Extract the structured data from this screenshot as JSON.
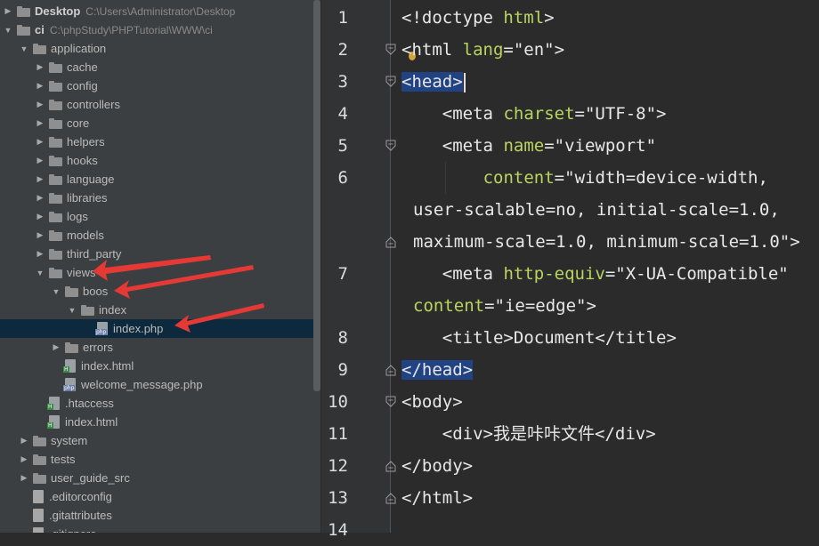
{
  "tree": [
    {
      "label": "Desktop",
      "path": "C:\\Users\\Administrator\\Desktop",
      "depth": 0,
      "kind": "folder",
      "state": "collapsed",
      "bold": true
    },
    {
      "label": "ci",
      "path": "C:\\phpStudy\\PHPTutorial\\WWW\\ci",
      "depth": 0,
      "kind": "folder",
      "state": "expanded",
      "bold": true
    },
    {
      "label": "application",
      "depth": 1,
      "kind": "folder",
      "state": "expanded"
    },
    {
      "label": "cache",
      "depth": 2,
      "kind": "folder",
      "state": "collapsed"
    },
    {
      "label": "config",
      "depth": 2,
      "kind": "folder",
      "state": "collapsed"
    },
    {
      "label": "controllers",
      "depth": 2,
      "kind": "folder",
      "state": "collapsed"
    },
    {
      "label": "core",
      "depth": 2,
      "kind": "folder",
      "state": "collapsed"
    },
    {
      "label": "helpers",
      "depth": 2,
      "kind": "folder",
      "state": "collapsed"
    },
    {
      "label": "hooks",
      "depth": 2,
      "kind": "folder",
      "state": "collapsed"
    },
    {
      "label": "language",
      "depth": 2,
      "kind": "folder",
      "state": "collapsed"
    },
    {
      "label": "libraries",
      "depth": 2,
      "kind": "folder",
      "state": "collapsed"
    },
    {
      "label": "logs",
      "depth": 2,
      "kind": "folder",
      "state": "collapsed"
    },
    {
      "label": "models",
      "depth": 2,
      "kind": "folder",
      "state": "collapsed"
    },
    {
      "label": "third_party",
      "depth": 2,
      "kind": "folder",
      "state": "collapsed"
    },
    {
      "label": "views",
      "depth": 2,
      "kind": "folder",
      "state": "expanded"
    },
    {
      "label": "boos",
      "depth": 3,
      "kind": "folder",
      "state": "expanded"
    },
    {
      "label": "index",
      "depth": 4,
      "kind": "folder",
      "state": "expanded"
    },
    {
      "label": "index.php",
      "depth": 5,
      "kind": "php",
      "selected": true
    },
    {
      "label": "errors",
      "depth": 3,
      "kind": "folder",
      "state": "collapsed"
    },
    {
      "label": "index.html",
      "depth": 3,
      "kind": "html"
    },
    {
      "label": "welcome_message.php",
      "depth": 3,
      "kind": "php"
    },
    {
      "label": ".htaccess",
      "depth": 2,
      "kind": "htaccess"
    },
    {
      "label": "index.html",
      "depth": 2,
      "kind": "html"
    },
    {
      "label": "system",
      "depth": 1,
      "kind": "folder",
      "state": "collapsed"
    },
    {
      "label": "tests",
      "depth": 1,
      "kind": "folder",
      "state": "collapsed"
    },
    {
      "label": "user_guide_src",
      "depth": 1,
      "kind": "folder",
      "state": "collapsed"
    },
    {
      "label": ".editorconfig",
      "depth": 1,
      "kind": "plain"
    },
    {
      "label": ".gitattributes",
      "depth": 1,
      "kind": "plain"
    },
    {
      "label": ".gitignore",
      "depth": 1,
      "kind": "plain"
    }
  ],
  "editor": {
    "line_numbers": [
      "1",
      "2",
      "3",
      "4",
      "5",
      "6",
      "",
      "",
      "7",
      "",
      "8",
      "9",
      "10",
      "11",
      "12",
      "13",
      "14"
    ],
    "lines": [
      {
        "indent": 0,
        "segs": [
          [
            "t",
            "<!doctype "
          ],
          [
            "an",
            "html"
          ],
          [
            "t",
            ">"
          ]
        ]
      },
      {
        "indent": 0,
        "segs": [
          [
            "t",
            "<html "
          ],
          [
            "an",
            "lang"
          ],
          [
            "t",
            "="
          ],
          [
            "s",
            "\"en\""
          ],
          [
            "t",
            ">"
          ]
        ]
      },
      {
        "indent": 0,
        "hl": true,
        "caret": true,
        "segs": [
          [
            "t",
            "<head>"
          ]
        ]
      },
      {
        "indent": 1,
        "segs": [
          [
            "t",
            "<meta "
          ],
          [
            "an",
            "charset"
          ],
          [
            "t",
            "="
          ],
          [
            "s",
            "\"UTF-8\""
          ],
          [
            "t",
            ">"
          ]
        ]
      },
      {
        "indent": 1,
        "segs": [
          [
            "t",
            "<meta "
          ],
          [
            "an",
            "name"
          ],
          [
            "t",
            "="
          ],
          [
            "s",
            "\"viewport\""
          ]
        ]
      },
      {
        "indent": 2,
        "segs": [
          [
            "an",
            "content"
          ],
          [
            "t",
            "="
          ],
          [
            "s",
            "\"width=device-width,"
          ]
        ]
      },
      {
        "indent": -1,
        "segs": [
          [
            "s",
            "user-scalable=no, initial-scale=1.0,"
          ]
        ]
      },
      {
        "indent": -1,
        "segs": [
          [
            "s",
            "maximum-scale=1.0, minimum-scale=1.0\""
          ],
          [
            "t",
            ">"
          ]
        ]
      },
      {
        "indent": 1,
        "segs": [
          [
            "t",
            "<meta "
          ],
          [
            "an",
            "http-equiv"
          ],
          [
            "t",
            "="
          ],
          [
            "s",
            "\"X-UA-Compatible\""
          ]
        ]
      },
      {
        "indent": -1,
        "segs": [
          [
            "an",
            "content"
          ],
          [
            "t",
            "="
          ],
          [
            "s",
            "\"ie=edge\""
          ],
          [
            "t",
            ">"
          ]
        ]
      },
      {
        "indent": 1,
        "segs": [
          [
            "t",
            "<title>"
          ],
          [
            "t",
            "Document"
          ],
          [
            "t",
            "</title>"
          ]
        ]
      },
      {
        "indent": 0,
        "hl": true,
        "segs": [
          [
            "t",
            "</head>"
          ]
        ]
      },
      {
        "indent": 0,
        "segs": [
          [
            "t",
            "<body>"
          ]
        ]
      },
      {
        "indent": 1,
        "segs": [
          [
            "t",
            "<div>"
          ],
          [
            "t",
            "我是咔咔文件"
          ],
          [
            "t",
            "</div>"
          ]
        ]
      },
      {
        "indent": 0,
        "segs": [
          [
            "t",
            "</body>"
          ]
        ]
      },
      {
        "indent": 0,
        "segs": [
          [
            "t",
            "</html>"
          ]
        ]
      },
      {
        "indent": 0,
        "segs": [
          [
            "t",
            ""
          ]
        ]
      }
    ]
  },
  "colors": {
    "accent_arrow": "#e53935",
    "selection": "#214283",
    "attr_name": "#bcd35f"
  }
}
